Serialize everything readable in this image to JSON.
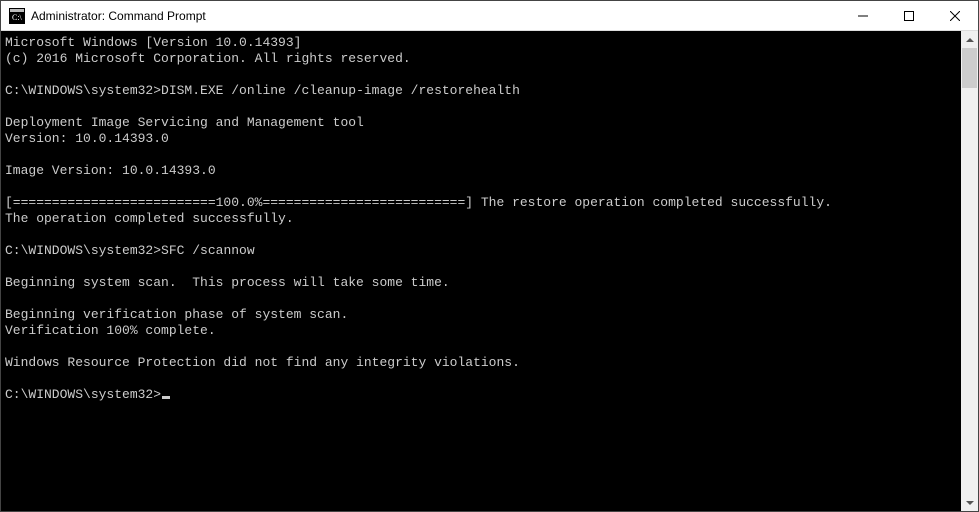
{
  "window": {
    "title": "Administrator: Command Prompt"
  },
  "terminal": {
    "prompt": "C:\\WINDOWS\\system32>",
    "header1": "Microsoft Windows [Version 10.0.14393]",
    "header2": "(c) 2016 Microsoft Corporation. All rights reserved.",
    "cmd1": "DISM.EXE /online /cleanup-image /restorehealth",
    "dism_title": "Deployment Image Servicing and Management tool",
    "dism_version": "Version: 10.0.14393.0",
    "dism_image_version": "Image Version: 10.0.14393.0",
    "dism_progress": "[==========================100.0%==========================] The restore operation completed successfully.",
    "dism_result": "The operation completed successfully.",
    "cmd2": "SFC /scannow",
    "sfc_begin": "Beginning system scan.  This process will take some time.",
    "sfc_phase": "Beginning verification phase of system scan.",
    "sfc_verify": "Verification 100% complete.",
    "sfc_result": "Windows Resource Protection did not find any integrity violations."
  }
}
